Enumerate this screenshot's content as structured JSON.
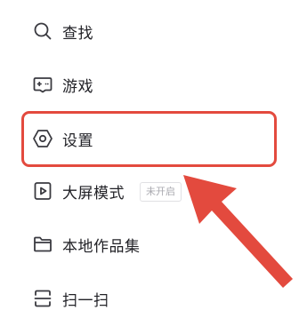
{
  "menu": {
    "items": [
      {
        "label": "查找",
        "icon": "search-icon"
      },
      {
        "label": "游戏",
        "icon": "gamepad-icon"
      },
      {
        "label": "设置",
        "icon": "settings-icon"
      },
      {
        "label": "大屏模式",
        "icon": "play-screen-icon",
        "badge": "未开启"
      },
      {
        "label": "本地作品集",
        "icon": "folder-icon"
      },
      {
        "label": "扫一扫",
        "icon": "scan-icon"
      }
    ]
  },
  "annotation": {
    "highlight_target": "设置",
    "color": "#e34a3e"
  },
  "colors": {
    "text": "#222227",
    "icon": "#3a3a40",
    "badge_text": "#a9a9af",
    "badge_border": "#e1e1e4",
    "annotation": "#e34a3e"
  }
}
